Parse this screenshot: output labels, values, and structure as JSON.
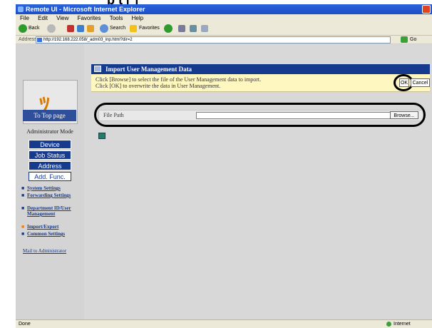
{
  "window": {
    "title": "Remote UI - Microsoft Internet Explorer"
  },
  "caption_strip": "p t  [ ]",
  "menu": [
    "File",
    "Edit",
    "View",
    "Favorites",
    "Tools",
    "Help"
  ],
  "toolbar": {
    "back_label": "Back",
    "search_label": "Search",
    "favorites_label": "Favorites"
  },
  "address": {
    "label": "Address",
    "url": "http://192.168.222.058/_adm03_inp.html?dir=2",
    "go_label": "Go"
  },
  "sidebar": {
    "top_page": "To Top page",
    "mode_label": "Administrator Mode",
    "nav": [
      "Device",
      "Job Status",
      "Address",
      "Add. Func."
    ],
    "links": [
      "System Settings",
      "Forwarding Settings",
      "Department ID/User Management",
      "Import/Export",
      "Common Settings"
    ],
    "mail_link": "Mail to Administrator"
  },
  "main": {
    "header_title": "Import User Management Data",
    "info_line1": "Click [Browse] to select the file of the User Management data to import.",
    "info_line2": "Click [OK] to overwrite the data in User Management.",
    "ok_label": "OK",
    "cancel_label": "Cancel",
    "file_path_label": "File Path",
    "file_path_value": "",
    "browse_label": "Browse..."
  },
  "status": {
    "left": "Done",
    "zone": "Internet"
  },
  "colors": {
    "nav_dark": "#163a8e",
    "header_bg": "#163a8e",
    "info_bg": "#fff7c0",
    "title_bar": "#2b63d9"
  }
}
